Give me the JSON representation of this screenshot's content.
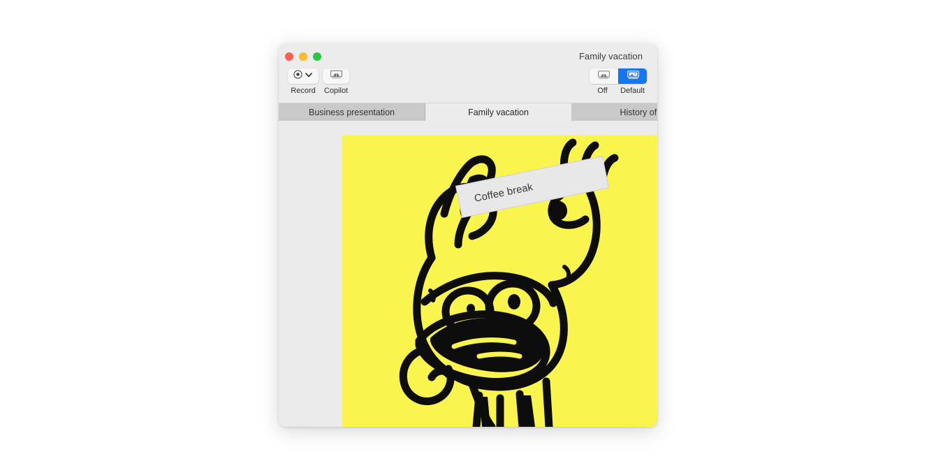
{
  "window": {
    "title": "Family vacation",
    "traffic_lights": [
      {
        "name": "close",
        "color": "#ff5f57"
      },
      {
        "name": "minimize",
        "color": "#febc2e"
      },
      {
        "name": "maximize",
        "color": "#28c840"
      }
    ]
  },
  "toolbar": {
    "left_items": [
      {
        "label": "Record",
        "icon": "record-dot-icon",
        "has_chevron": true
      },
      {
        "label": "Copilot",
        "icon": "copilot-presenter-icon",
        "has_chevron": false
      }
    ],
    "display_mode": {
      "options": [
        {
          "label": "Off",
          "icon": "presenter-display-off-icon",
          "selected": false
        },
        {
          "label": "Default",
          "icon": "presenter-display-default-icon",
          "selected": true
        }
      ],
      "accent_color": "#1476f2"
    }
  },
  "tabs": [
    {
      "label": "Business presentation",
      "active": false
    },
    {
      "label": "Family vacation",
      "active": true
    },
    {
      "label": "History of Ca",
      "active": false
    }
  ],
  "content": {
    "background_color": "#ebebeb",
    "slide": {
      "background_color": "#faf44f",
      "artwork_name": "cartoon-character-arms-raised"
    },
    "note": {
      "text": "Coffee break",
      "background_color": "#e8e8e8",
      "rotation_degrees": -11.5
    }
  }
}
